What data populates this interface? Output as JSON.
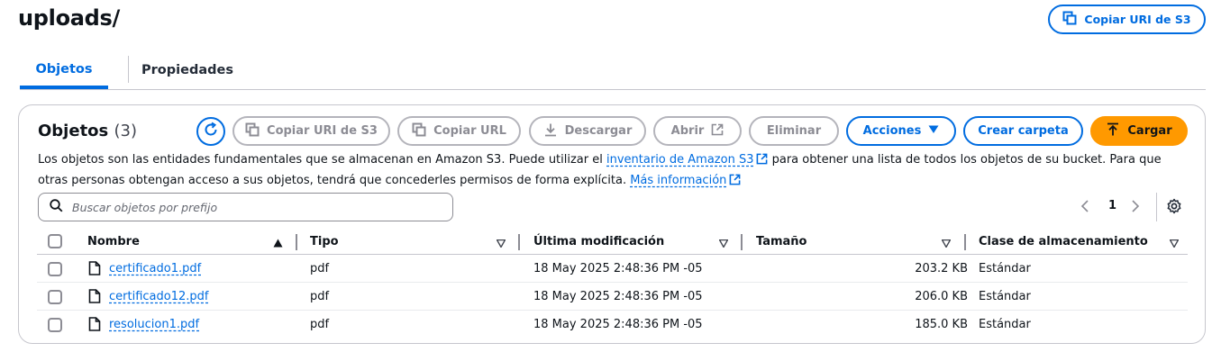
{
  "header": {
    "title": "uploads/",
    "copy_uri_label": "Copiar URI de S3"
  },
  "tabs": [
    {
      "label": "Objetos",
      "active": true
    },
    {
      "label": "Propiedades",
      "active": false
    }
  ],
  "panel": {
    "title": "Objetos",
    "count": "(3)",
    "toolbar": {
      "copy_uri": "Copiar URI de S3",
      "copy_url": "Copiar URL",
      "download": "Descargar",
      "open": "Abrir",
      "delete": "Eliminar",
      "actions": "Acciones",
      "create_folder": "Crear carpeta",
      "upload": "Cargar"
    },
    "description": {
      "part1": "Los objetos son las entidades fundamentales que se almacenan en Amazon S3. Puede utilizar el ",
      "link1": "inventario de Amazon S3",
      "part2": " para obtener una lista de todos los objetos de su bucket. Para que otras personas obtengan acceso a sus objetos, tendrá que concederles permisos de forma explícita. ",
      "link2": "Más información"
    },
    "search": {
      "placeholder": "Buscar objetos por prefijo",
      "value": ""
    },
    "pagination": {
      "current_page": "1"
    },
    "columns": {
      "name": "Nombre",
      "type": "Tipo",
      "modified": "Última modificación",
      "size": "Tamaño",
      "storage_class": "Clase de almacenamiento"
    },
    "rows": [
      {
        "name": "certificado1.pdf",
        "type": "pdf",
        "modified": "18 May 2025 2:48:36 PM -05",
        "size": "203.2 KB",
        "storage_class": "Estándar"
      },
      {
        "name": "certificado12.pdf",
        "type": "pdf",
        "modified": "18 May 2025 2:48:36 PM -05",
        "size": "206.0 KB",
        "storage_class": "Estándar"
      },
      {
        "name": "resolucion1.pdf",
        "type": "pdf",
        "modified": "18 May 2025 2:48:36 PM -05",
        "size": "185.0 KB",
        "storage_class": "Estándar"
      }
    ]
  },
  "colors": {
    "accent": "#006ce0",
    "upload": "#ff9900",
    "disabled": "#8c8c94"
  },
  "icons": [
    "copy-icon",
    "refresh-icon",
    "download-icon",
    "external-link-icon",
    "caret-down-icon",
    "upload-icon",
    "search-icon",
    "chevron-left-icon",
    "chevron-right-icon",
    "gear-icon",
    "file-icon",
    "sort-asc-icon",
    "sort-desc-icon"
  ]
}
